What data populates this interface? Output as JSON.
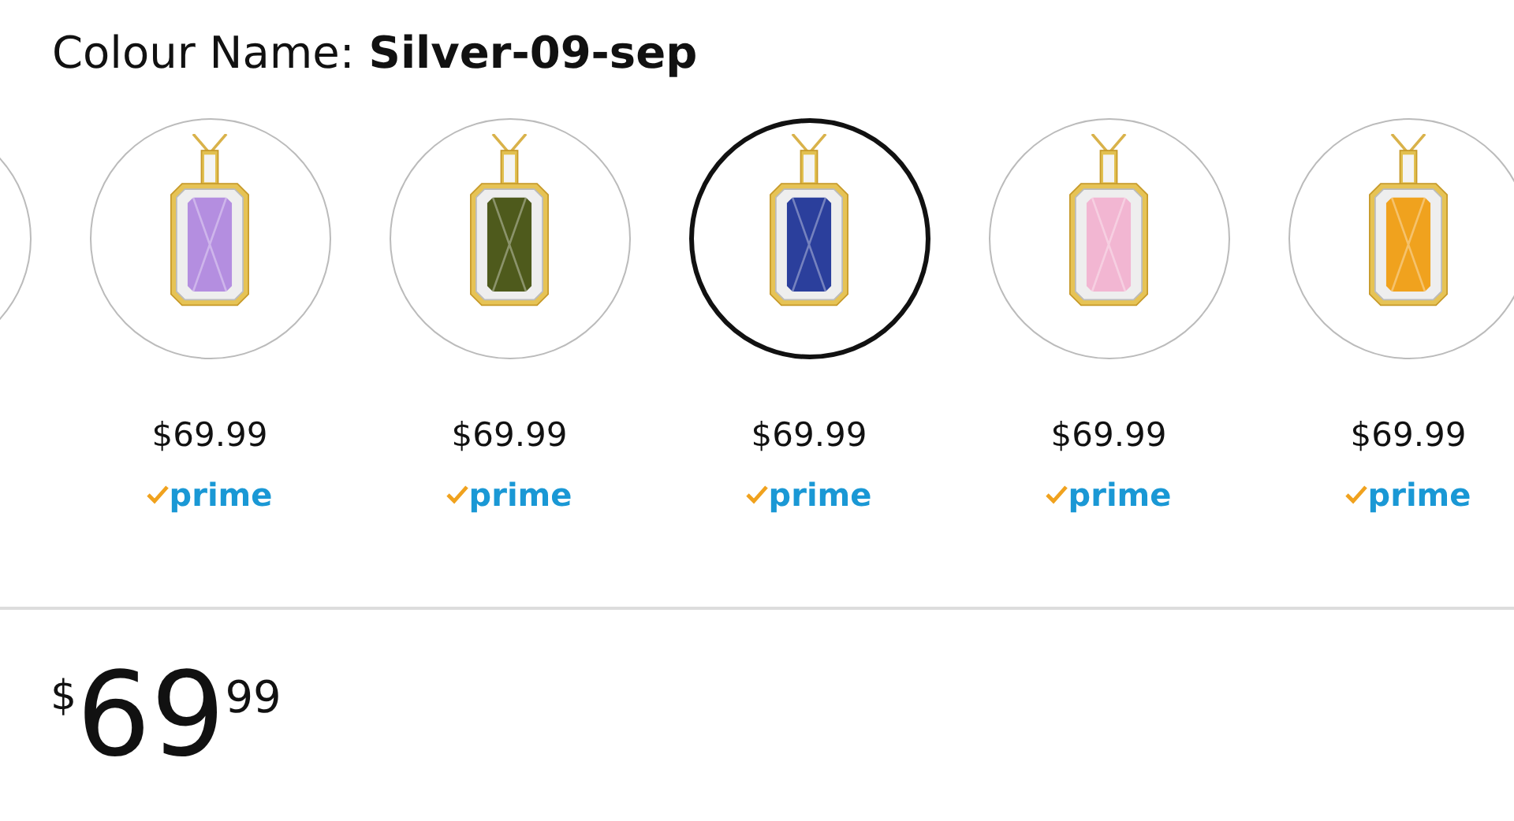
{
  "colour_name": {
    "label": "Colour Name:",
    "value": "Silver-09-sep"
  },
  "variants": [
    {
      "color": "#b48ee0",
      "selected": false,
      "price": "$69.99",
      "prime": "prime"
    },
    {
      "color": "#4e5a1c",
      "selected": false,
      "price": "$69.99",
      "prime": "prime"
    },
    {
      "color": "#2b3f9c",
      "selected": true,
      "price": "$69.99",
      "prime": "prime"
    },
    {
      "color": "#f2b6d2",
      "selected": false,
      "price": "$69.99",
      "prime": "prime"
    },
    {
      "color": "#f0a21e",
      "selected": false,
      "price": "$69.99",
      "prime": "prime"
    }
  ],
  "price": {
    "currency": "$",
    "whole": "69",
    "fraction": "99"
  }
}
